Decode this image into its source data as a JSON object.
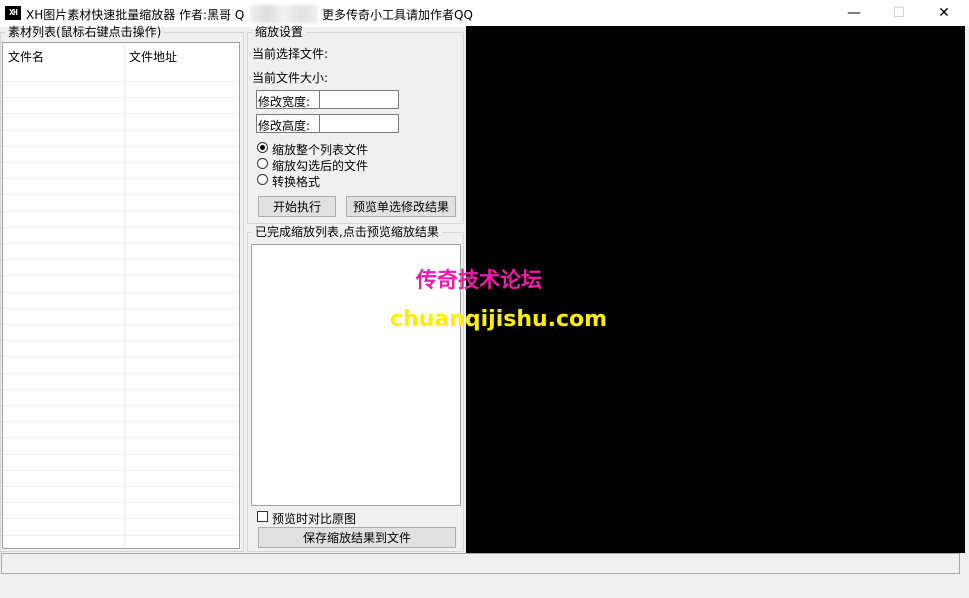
{
  "window": {
    "title": "XH图片素材快速批量缩放器 作者:黑哥 Q",
    "title_suffix": "更多传奇小工具请加作者QQ",
    "app_icon_text": "XH",
    "minimize_glyph": "—",
    "maximize_glyph": "☐",
    "close_glyph": "✕"
  },
  "material_list": {
    "legend": "素材列表(鼠标右键点击操作)",
    "columns": [
      "文件名",
      "文件地址"
    ],
    "rows": []
  },
  "scale_settings": {
    "legend": "缩放设置",
    "current_file_label": "当前选择文件:",
    "current_size_label": "当前文件大小:",
    "width_label": "修改宽度:",
    "width_value": "",
    "height_label": "修改高度:",
    "height_value": "",
    "options": [
      {
        "label": "缩放整个列表文件",
        "selected": true
      },
      {
        "label": "缩放勾选后的文件",
        "selected": false
      },
      {
        "label": "转换格式",
        "selected": false
      }
    ],
    "start_button": "开始执行",
    "preview_button": "预览单选修改结果"
  },
  "results": {
    "legend": "已完成缩放列表,点击预览缩放结果",
    "items": [],
    "compare_checkbox_label": "预览时对比原图",
    "compare_checked": false,
    "save_button": "保存缩放结果到文件"
  },
  "watermark": {
    "line1": "传奇技术论坛",
    "line2": "chuanqijishu.com",
    "color1": "#ee1aa8",
    "color2": "#ffee00"
  },
  "preview": {
    "background": "#000000"
  },
  "status_text": ""
}
